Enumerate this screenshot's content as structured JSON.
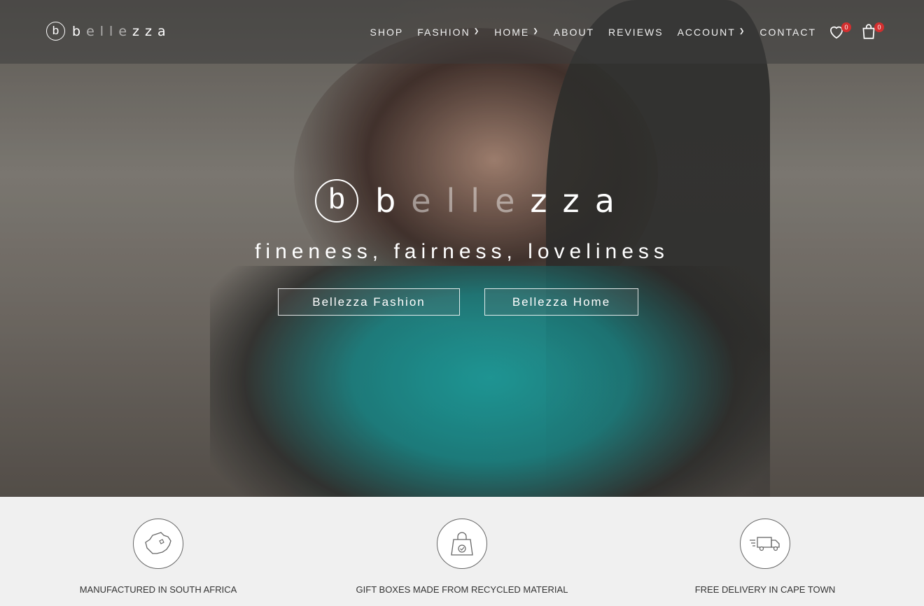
{
  "brand": {
    "mark": "b",
    "word_parts": [
      "b",
      "e",
      "l",
      "l",
      "e",
      "z",
      "z",
      "a"
    ],
    "dim_letters": [
      1,
      2,
      3,
      4
    ]
  },
  "nav": {
    "items": [
      {
        "label": "SHOP",
        "has_dropdown": false
      },
      {
        "label": "FASHION",
        "has_dropdown": true
      },
      {
        "label": "HOME",
        "has_dropdown": true
      },
      {
        "label": "ABOUT",
        "has_dropdown": false
      },
      {
        "label": "REVIEWS",
        "has_dropdown": false
      },
      {
        "label": "ACCOUNT",
        "has_dropdown": true
      },
      {
        "label": "CONTACT",
        "has_dropdown": false
      }
    ],
    "wishlist_count": "0",
    "cart_count": "0",
    "wishlist_icon": "heart-icon",
    "cart_icon": "shopping-bag-icon"
  },
  "hero": {
    "tagline": "fineness, fairness, loveliness",
    "buttons": {
      "fashion": "Bellezza Fashion",
      "home": "Bellezza Home"
    }
  },
  "features": [
    {
      "label": "MANUFACTURED IN SOUTH AFRICA",
      "icon": "south-africa-map-icon"
    },
    {
      "label": "GIFT BOXES MADE FROM RECYCLED MATERIAL",
      "icon": "gift-bag-icon"
    },
    {
      "label": "FREE DELIVERY IN CAPE TOWN",
      "icon": "delivery-truck-icon"
    }
  ],
  "colors": {
    "badge": "#d32f2f",
    "scarf_teal": "#1f9c9a"
  }
}
